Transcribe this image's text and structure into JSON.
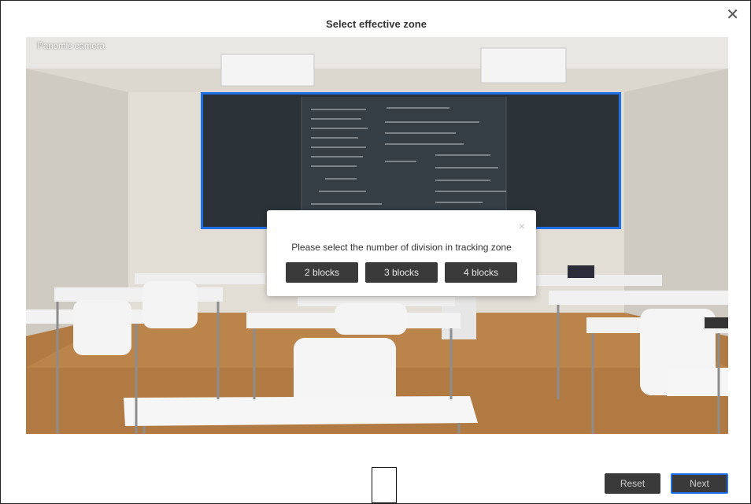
{
  "header": {
    "title": "Select effective zone",
    "close_icon": "close-icon"
  },
  "camera": {
    "label": "Panomic camera"
  },
  "dialog": {
    "message": "Please select the number of division in tracking zone",
    "close_glyph": "×",
    "options": [
      "2 blocks",
      "3 blocks",
      "4 blocks"
    ]
  },
  "footer": {
    "reset_label": "Reset",
    "next_label": "Next"
  },
  "colors": {
    "accent": "#1f6fe8",
    "button_bg": "#3a3a3a"
  }
}
